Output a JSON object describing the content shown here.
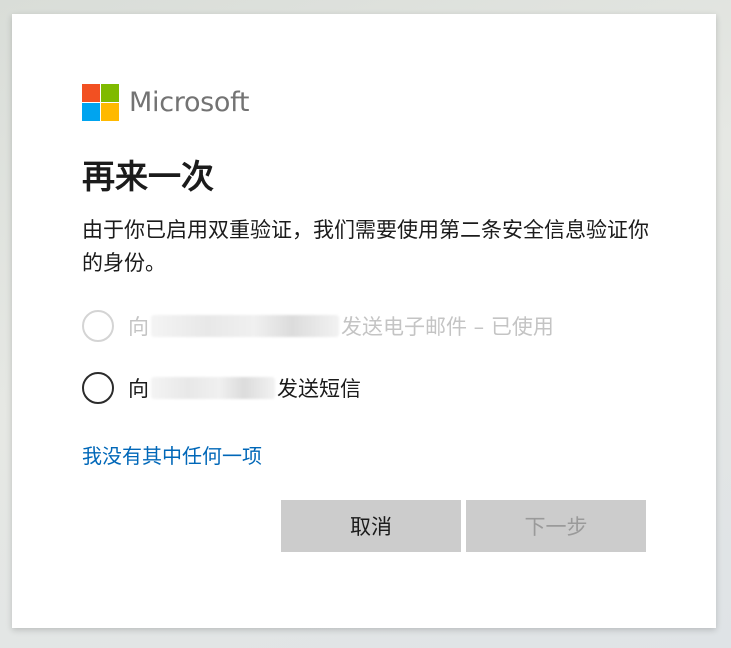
{
  "logo": {
    "text": "Microsoft",
    "colors": [
      "#f25022",
      "#7fba00",
      "#00a4ef",
      "#ffb900"
    ]
  },
  "title": "再来一次",
  "description": "由于你已启用双重验证，我们需要使用第二条安全信息验证你的身份。",
  "options": [
    {
      "prefix": "向",
      "suffix": "发送电子邮件 – 已使用",
      "disabled": true,
      "selected": false
    },
    {
      "prefix": "向",
      "suffix": "发送短信",
      "disabled": false,
      "selected": false
    }
  ],
  "link": "我没有其中任何一项",
  "buttons": {
    "cancel": "取消",
    "next": "下一步"
  },
  "colors": {
    "link": "#0067b8",
    "button_bg": "#cccccc",
    "disabled_text": "#c4c4c4"
  }
}
